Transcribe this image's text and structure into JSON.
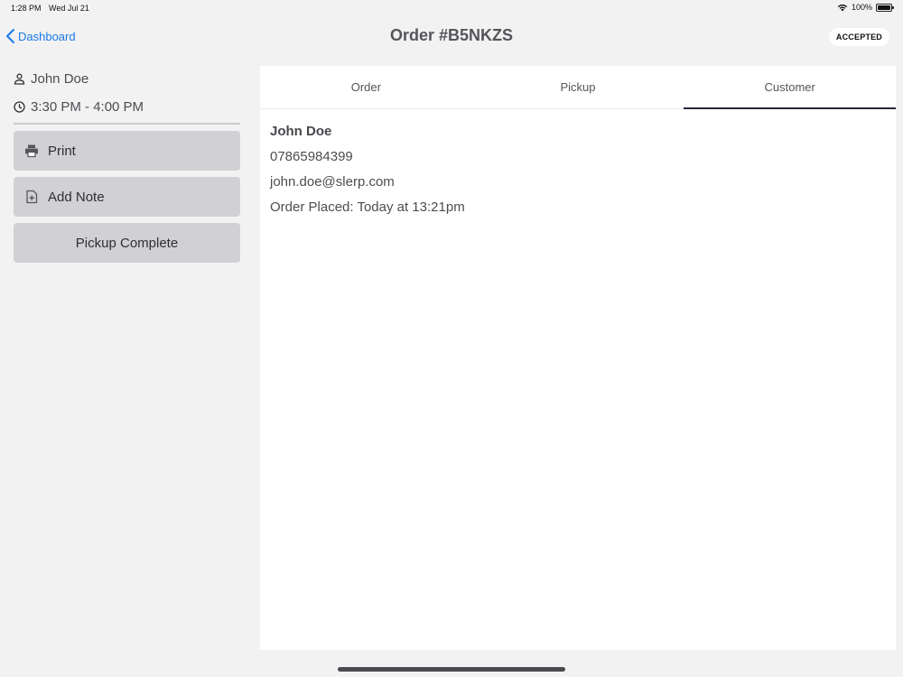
{
  "status_bar": {
    "time": "1:28 PM",
    "date": "Wed Jul 21",
    "battery_text": "100%",
    "battery_level": 1.0,
    "icons": [
      "wifi-icon",
      "battery-icon"
    ]
  },
  "nav": {
    "back_label": "Dashboard",
    "title": "Order #B5NKZS",
    "status_badge": "ACCEPTED",
    "accent_color": "#1a7ae6"
  },
  "sidebar": {
    "customer_name": "John Doe",
    "pickup_window": "3:30 PM - 4:00 PM",
    "buttons": {
      "print": "Print",
      "add_note": "Add Note",
      "pickup_complete": "Pickup Complete"
    }
  },
  "tabs": [
    {
      "label": "Order",
      "active": false
    },
    {
      "label": "Pickup",
      "active": false
    },
    {
      "label": "Customer",
      "active": true
    }
  ],
  "customer": {
    "name": "John Doe",
    "phone": "07865984399",
    "email": "john.doe@slerp.com",
    "order_placed": "Order Placed: Today at 13:21pm"
  }
}
